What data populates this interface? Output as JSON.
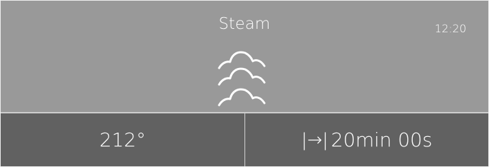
{
  "header": {
    "mode_title": "Steam",
    "clock": "12:20"
  },
  "icons": {
    "mode_icon": "steam-icon"
  },
  "settings": {
    "temperature": "212°",
    "duration_icon": "|→|",
    "duration": "20min 00s"
  },
  "colors": {
    "top_panel": "#999999",
    "bottom_panel": "#616161",
    "divider": "#d4d4d4",
    "text": "#ffffff"
  }
}
